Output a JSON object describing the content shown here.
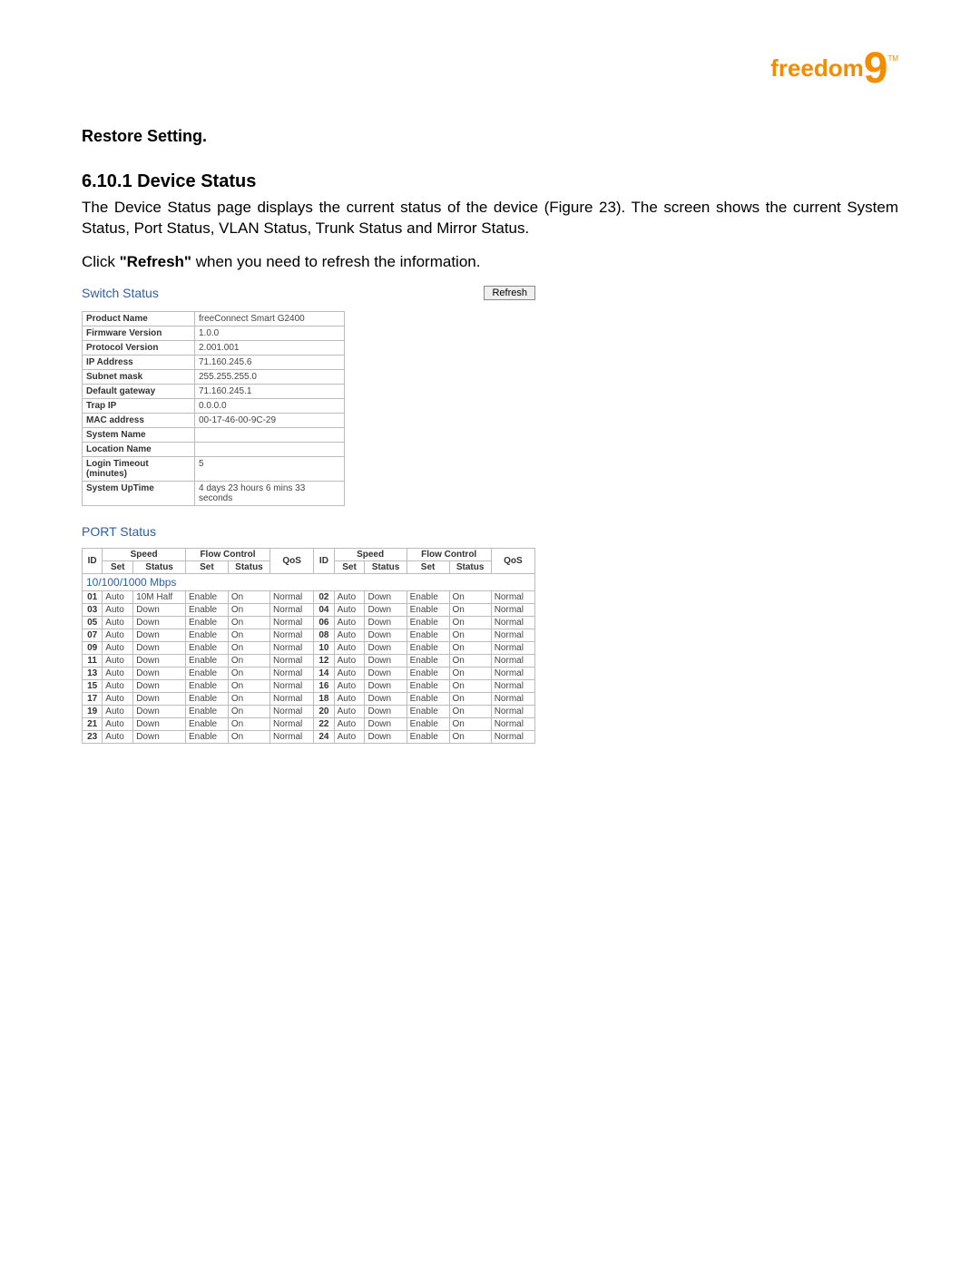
{
  "logo": {
    "brand": "freedom",
    "nine": "9",
    "tm": "TM"
  },
  "restore_setting": "Restore Setting",
  "section": {
    "number": "6.10.1",
    "title": "Device Status",
    "heading": "6.10.1 Device Status"
  },
  "para1_a": "The Device Status page displays the current status of the device (Figure 23).  The screen shows the current System Status, Port Status, VLAN Status, Trunk Status and Mirror Status.",
  "para2_pre": "Click ",
  "para2_bold": "\"Refresh\"",
  "para2_post": " when you need to refresh the information.",
  "switch_status_title": "Switch Status",
  "refresh_button": "Refresh",
  "system_rows": [
    {
      "k": "Product Name",
      "v": "freeConnect Smart G2400"
    },
    {
      "k": "Firmware Version",
      "v": "1.0.0"
    },
    {
      "k": "Protocol Version",
      "v": "2.001.001"
    },
    {
      "k": "IP Address",
      "v": "71.160.245.6"
    },
    {
      "k": "Subnet mask",
      "v": "255.255.255.0"
    },
    {
      "k": "Default gateway",
      "v": "71.160.245.1"
    },
    {
      "k": "Trap IP",
      "v": "0.0.0.0"
    },
    {
      "k": "MAC address",
      "v": "00-17-46-00-9C-29"
    },
    {
      "k": "System Name",
      "v": ""
    },
    {
      "k": "Location Name",
      "v": ""
    },
    {
      "k": "Login Timeout (minutes)",
      "v": "5"
    },
    {
      "k": "System UpTime",
      "v": "4 days 23 hours 6 mins 33 seconds"
    }
  ],
  "port_status_title": "PORT Status",
  "port_headers": {
    "id": "ID",
    "speed": "Speed",
    "flow": "Flow Control",
    "qos": "QoS",
    "set": "Set",
    "status": "Status"
  },
  "port_section": "10/100/1000 Mbps",
  "port_rows": [
    {
      "l": {
        "id": "01",
        "set": "Auto",
        "status": "10M Half",
        "fset": "Enable",
        "fstatus": "On",
        "qos": "Normal"
      },
      "r": {
        "id": "02",
        "set": "Auto",
        "status": "Down",
        "fset": "Enable",
        "fstatus": "On",
        "qos": "Normal"
      }
    },
    {
      "l": {
        "id": "03",
        "set": "Auto",
        "status": "Down",
        "fset": "Enable",
        "fstatus": "On",
        "qos": "Normal"
      },
      "r": {
        "id": "04",
        "set": "Auto",
        "status": "Down",
        "fset": "Enable",
        "fstatus": "On",
        "qos": "Normal"
      }
    },
    {
      "l": {
        "id": "05",
        "set": "Auto",
        "status": "Down",
        "fset": "Enable",
        "fstatus": "On",
        "qos": "Normal"
      },
      "r": {
        "id": "06",
        "set": "Auto",
        "status": "Down",
        "fset": "Enable",
        "fstatus": "On",
        "qos": "Normal"
      }
    },
    {
      "l": {
        "id": "07",
        "set": "Auto",
        "status": "Down",
        "fset": "Enable",
        "fstatus": "On",
        "qos": "Normal"
      },
      "r": {
        "id": "08",
        "set": "Auto",
        "status": "Down",
        "fset": "Enable",
        "fstatus": "On",
        "qos": "Normal"
      }
    },
    {
      "l": {
        "id": "09",
        "set": "Auto",
        "status": "Down",
        "fset": "Enable",
        "fstatus": "On",
        "qos": "Normal"
      },
      "r": {
        "id": "10",
        "set": "Auto",
        "status": "Down",
        "fset": "Enable",
        "fstatus": "On",
        "qos": "Normal"
      }
    },
    {
      "l": {
        "id": "11",
        "set": "Auto",
        "status": "Down",
        "fset": "Enable",
        "fstatus": "On",
        "qos": "Normal"
      },
      "r": {
        "id": "12",
        "set": "Auto",
        "status": "Down",
        "fset": "Enable",
        "fstatus": "On",
        "qos": "Normal"
      }
    },
    {
      "l": {
        "id": "13",
        "set": "Auto",
        "status": "Down",
        "fset": "Enable",
        "fstatus": "On",
        "qos": "Normal"
      },
      "r": {
        "id": "14",
        "set": "Auto",
        "status": "Down",
        "fset": "Enable",
        "fstatus": "On",
        "qos": "Normal"
      }
    },
    {
      "l": {
        "id": "15",
        "set": "Auto",
        "status": "Down",
        "fset": "Enable",
        "fstatus": "On",
        "qos": "Normal"
      },
      "r": {
        "id": "16",
        "set": "Auto",
        "status": "Down",
        "fset": "Enable",
        "fstatus": "On",
        "qos": "Normal"
      }
    },
    {
      "l": {
        "id": "17",
        "set": "Auto",
        "status": "Down",
        "fset": "Enable",
        "fstatus": "On",
        "qos": "Normal"
      },
      "r": {
        "id": "18",
        "set": "Auto",
        "status": "Down",
        "fset": "Enable",
        "fstatus": "On",
        "qos": "Normal"
      }
    },
    {
      "l": {
        "id": "19",
        "set": "Auto",
        "status": "Down",
        "fset": "Enable",
        "fstatus": "On",
        "qos": "Normal"
      },
      "r": {
        "id": "20",
        "set": "Auto",
        "status": "Down",
        "fset": "Enable",
        "fstatus": "On",
        "qos": "Normal"
      }
    },
    {
      "l": {
        "id": "21",
        "set": "Auto",
        "status": "Down",
        "fset": "Enable",
        "fstatus": "On",
        "qos": "Normal"
      },
      "r": {
        "id": "22",
        "set": "Auto",
        "status": "Down",
        "fset": "Enable",
        "fstatus": "On",
        "qos": "Normal"
      }
    },
    {
      "l": {
        "id": "23",
        "set": "Auto",
        "status": "Down",
        "fset": "Enable",
        "fstatus": "On",
        "qos": "Normal"
      },
      "r": {
        "id": "24",
        "set": "Auto",
        "status": "Down",
        "fset": "Enable",
        "fstatus": "On",
        "qos": "Normal"
      }
    }
  ]
}
